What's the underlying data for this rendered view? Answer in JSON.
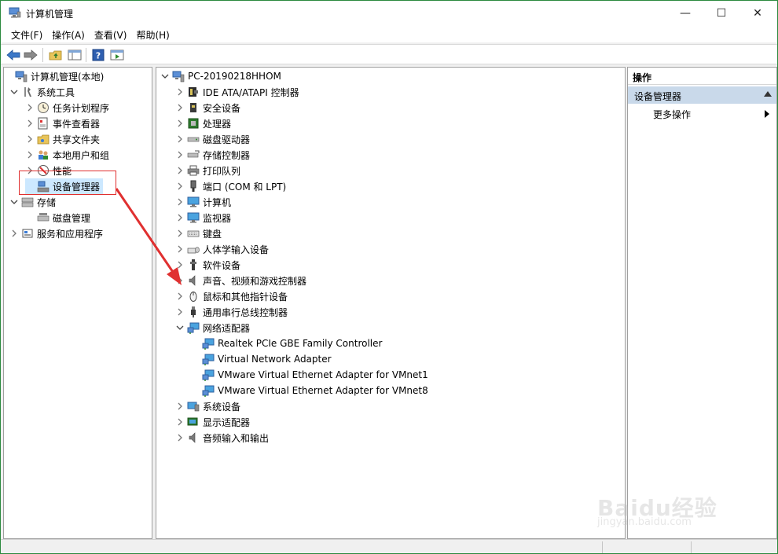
{
  "window": {
    "title": "计算机管理"
  },
  "titlebar": {
    "minimize": "—",
    "maximize": "☐",
    "close": "✕"
  },
  "menu": [
    "文件(F)",
    "操作(A)",
    "查看(V)",
    "帮助(H)"
  ],
  "left_tree": [
    {
      "label": "计算机管理(本地)",
      "icon": "computer-management-icon",
      "chev": ""
    },
    {
      "label": "系统工具",
      "icon": "system-tools-icon",
      "chev": "⌄"
    },
    {
      "label": "任务计划程序",
      "icon": "clock-icon",
      "chev": "›"
    },
    {
      "label": "事件查看器",
      "icon": "event-viewer-icon",
      "chev": "›"
    },
    {
      "label": "共享文件夹",
      "icon": "shared-folder-icon",
      "chev": "›"
    },
    {
      "label": "本地用户和组",
      "icon": "users-icon",
      "chev": "›"
    },
    {
      "label": "性能",
      "icon": "performance-icon",
      "chev": "›"
    },
    {
      "label": "设备管理器",
      "icon": "device-manager-icon",
      "chev": ""
    },
    {
      "label": "存储",
      "icon": "storage-icon",
      "chev": "⌄"
    },
    {
      "label": "磁盘管理",
      "icon": "disk-management-icon",
      "chev": ""
    },
    {
      "label": "服务和应用程序",
      "icon": "services-icon",
      "chev": "›"
    }
  ],
  "device_tree": [
    {
      "label": "PC-20190218HHOM",
      "icon": "computer-tower-icon",
      "chev": "⌄"
    },
    {
      "label": "IDE ATA/ATAPI 控制器",
      "icon": "ide-controller-icon",
      "chev": "›"
    },
    {
      "label": "安全设备",
      "icon": "security-device-icon",
      "chev": "›"
    },
    {
      "label": "处理器",
      "icon": "processor-icon",
      "chev": "›"
    },
    {
      "label": "磁盘驱动器",
      "icon": "disk-drive-icon",
      "chev": "›"
    },
    {
      "label": "存储控制器",
      "icon": "storage-controller-icon",
      "chev": "›"
    },
    {
      "label": "打印队列",
      "icon": "printer-icon",
      "chev": "›"
    },
    {
      "label": "端口 (COM 和 LPT)",
      "icon": "port-icon",
      "chev": "›"
    },
    {
      "label": "计算机",
      "icon": "monitor-icon",
      "chev": "›"
    },
    {
      "label": "监视器",
      "icon": "monitor-icon",
      "chev": "›"
    },
    {
      "label": "键盘",
      "icon": "keyboard-icon",
      "chev": "›"
    },
    {
      "label": "人体学输入设备",
      "icon": "hid-icon",
      "chev": "›"
    },
    {
      "label": "软件设备",
      "icon": "software-device-icon",
      "chev": "›"
    },
    {
      "label": "声音、视频和游戏控制器",
      "icon": "speaker-icon",
      "chev": "›"
    },
    {
      "label": "鼠标和其他指针设备",
      "icon": "mouse-icon",
      "chev": "›"
    },
    {
      "label": "通用串行总线控制器",
      "icon": "usb-icon",
      "chev": "›"
    },
    {
      "label": "网络适配器",
      "icon": "network-adapter-icon",
      "chev": "⌄"
    },
    {
      "label": "Realtek PCIe GBE Family Controller",
      "icon": "network-adapter-icon",
      "chev": ""
    },
    {
      "label": "Virtual Network Adapter",
      "icon": "network-adapter-icon",
      "chev": ""
    },
    {
      "label": "VMware Virtual Ethernet Adapter for VMnet1",
      "icon": "network-adapter-icon",
      "chev": ""
    },
    {
      "label": "VMware Virtual Ethernet Adapter for VMnet8",
      "icon": "network-adapter-icon",
      "chev": ""
    },
    {
      "label": "系统设备",
      "icon": "system-device-icon",
      "chev": "›"
    },
    {
      "label": "显示适配器",
      "icon": "display-adapter-icon",
      "chev": "›"
    },
    {
      "label": "音频输入和输出",
      "icon": "audio-io-icon",
      "chev": "›"
    }
  ],
  "actions": {
    "header": "操作",
    "section": "设备管理器",
    "more": "更多操作"
  },
  "watermark": {
    "logo": "Baidu经验",
    "url": "jingyan.baidu.com"
  },
  "colors": {
    "accent": "#2b8a3e",
    "selection": "#cce8ff",
    "actions_section": "#c9d9ea",
    "annotation": "#e03030"
  }
}
